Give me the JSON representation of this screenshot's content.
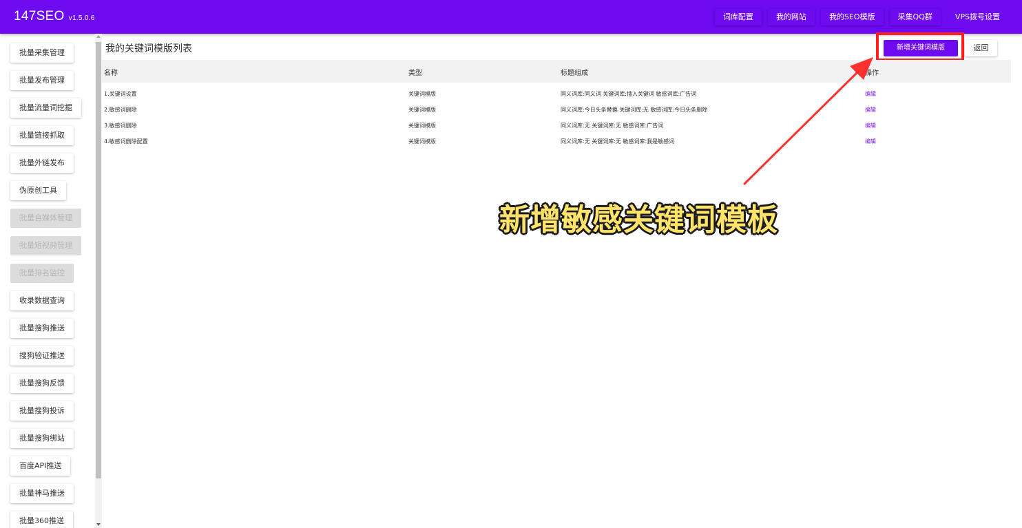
{
  "app": {
    "title": "147SEO",
    "version": "v1.5.0.6"
  },
  "topnav": [
    {
      "label": "词库配置"
    },
    {
      "label": "我的网站"
    },
    {
      "label": "我的SEO模版"
    },
    {
      "label": "采集QQ群"
    },
    {
      "label": "VPS拨号设置"
    }
  ],
  "sidebar": {
    "items": [
      {
        "label": "批量采集管理",
        "disabled": false
      },
      {
        "label": "批量发布管理",
        "disabled": false
      },
      {
        "label": "批量流量词挖掘",
        "disabled": false
      },
      {
        "label": "批量链接抓取",
        "disabled": false
      },
      {
        "label": "批量外链发布",
        "disabled": false
      },
      {
        "label": "伪原创工具",
        "disabled": false
      },
      {
        "label": "批量自媒体管理",
        "disabled": true
      },
      {
        "label": "批量短视频管理",
        "disabled": true
      },
      {
        "label": "批量排名监控",
        "disabled": true
      },
      {
        "label": "收录数据查询",
        "disabled": false
      },
      {
        "label": "批量搜狗推送",
        "disabled": false
      },
      {
        "label": "搜狗验证推送",
        "disabled": false
      },
      {
        "label": "批量搜狗反馈",
        "disabled": false
      },
      {
        "label": "批量搜狗投诉",
        "disabled": false
      },
      {
        "label": "批量搜狗绑站",
        "disabled": false
      },
      {
        "label": "百度API推送",
        "disabled": false
      },
      {
        "label": "批量神马推送",
        "disabled": false
      },
      {
        "label": "批量360推送",
        "disabled": false
      }
    ]
  },
  "main": {
    "title": "我的关键词模版列表",
    "add_button": "新增关键词模版",
    "back_button": "返回",
    "columns": [
      "名称",
      "类型",
      "标题组成",
      "操作"
    ],
    "rows": [
      {
        "name": "1.关键词设置",
        "type": "关键词模版",
        "composition": "同义词库:同义词 关键词库:插入关键词 敏感词库:广告词",
        "action": "编辑"
      },
      {
        "name": "2.敏感词删除",
        "type": "关键词模版",
        "composition": "同义词库:今日头条替换 关键词库:无 敏感词库:今日头条删除",
        "action": "编辑"
      },
      {
        "name": "3.敏感词删除",
        "type": "关键词模版",
        "composition": "同义词库:无 关键词库:无 敏感词库:广告词",
        "action": "编辑"
      },
      {
        "name": "4.敏感词删除配置",
        "type": "关键词模版",
        "composition": "同义词库:无 关键词库:无 敏感词库:我是敏感词",
        "action": "编辑"
      }
    ]
  },
  "annotation": {
    "text": "新增敏感关键词模板",
    "arrow_color": "#ff3030",
    "text_color": "#ffe36a"
  },
  "colors": {
    "brand": "#6d0af0",
    "link": "#7a1cf0",
    "highlight": "#ff2020"
  }
}
